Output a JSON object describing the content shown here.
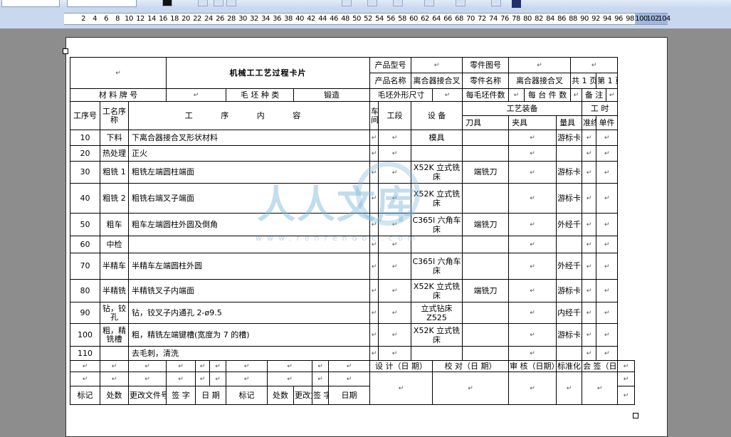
{
  "ruler": {
    "ticks": [
      "2",
      "4",
      "6",
      "8",
      "10",
      "12",
      "14",
      "16",
      "18",
      "20",
      "22",
      "24",
      "26",
      "28",
      "30",
      "32",
      "34",
      "36",
      "38",
      "40",
      "42",
      "44",
      "46",
      "48",
      "50",
      "52",
      "54",
      "56",
      "58",
      "60",
      "62",
      "64",
      "66",
      "68",
      "70",
      "72",
      "74",
      "76",
      "78",
      "80",
      "82",
      "84",
      "86",
      "88",
      "90",
      "92",
      "94",
      "96",
      "98",
      "100",
      "102",
      "104"
    ]
  },
  "card": {
    "title": "机械工工艺过程卡片",
    "product_model_label": "产品型号",
    "part_drawing_label": "零件图号",
    "product_name_label": "产品名称",
    "product_name_value": "离合器接合叉",
    "part_name_label": "零件名称",
    "part_name_value": "离合器接合叉",
    "total_label": "共",
    "total_value": "1",
    "page_label": "页",
    "sheet_label": "第",
    "sheet_value": "1",
    "sheet_page_label": "页",
    "material_label": "材 料 牌 号",
    "blank_type_label": "毛 坯 种 类",
    "blank_type_value": "锻造",
    "blank_size_label": "毛坯外形尺寸",
    "per_blank_label": "每毛坯件数",
    "per_unit_label": "每 台 件 数",
    "notes_label": "备 注",
    "hdr_process_no": "工序号",
    "hdr_process_name": "工名序称",
    "hdr_content": "工 序 内 容",
    "hdr_workshop": "车间",
    "hdr_section": "工段",
    "hdr_equipment": "设 备",
    "hdr_tooling": "工艺装备",
    "hdr_time": "工 时",
    "hdr_cutter": "刀具",
    "hdr_fixture": "夹具",
    "hdr_gauge": "量具",
    "hdr_setup": "准终",
    "hdr_unit": "单件",
    "rows": [
      {
        "no": "10",
        "name": "下料",
        "content": "下离合器接合叉形状材料",
        "equipment": "模具",
        "cutter": "",
        "gauge": "游标卡尺"
      },
      {
        "no": "20",
        "name": "热处理",
        "content": "正火",
        "equipment": "",
        "cutter": "",
        "gauge": ""
      },
      {
        "no": "30",
        "name": "粗铣 1",
        "content": "粗铣左端圆柱端面",
        "equipment": "X52K 立式铣床",
        "cutter": "端铣刀",
        "gauge": "游标卡尺"
      },
      {
        "no": "40",
        "name": "粗铣 2",
        "content": "粗铣右端叉子端面",
        "equipment": "X52K 立式铣床",
        "cutter": "",
        "gauge": "游标卡尺"
      },
      {
        "no": "50",
        "name": "粗车",
        "content": "粗车左端圆柱外圆及倒角",
        "equipment": "C365l 六角车床",
        "cutter": "端铣刀",
        "gauge": "外经千分尺"
      },
      {
        "no": "60",
        "name": "中检",
        "content": "",
        "equipment": "",
        "cutter": "",
        "gauge": ""
      },
      {
        "no": "70",
        "name": "半精车",
        "content": "半精车左端圆柱外圆",
        "equipment": "C365l 六角车床",
        "cutter": "",
        "gauge": "外经千分尺"
      },
      {
        "no": "80",
        "name": "半精铣",
        "content": "半精铣叉子内端面",
        "equipment": "X52K 立式铣床",
        "cutter": "端铣刀",
        "gauge": "游标卡尺"
      },
      {
        "no": "90",
        "name": "钻，铰孔",
        "content": "钻，铰叉子内通孔 2-ø9.5",
        "equipment": "立式钻床 Z525",
        "cutter": "",
        "gauge": "内经千分尺"
      },
      {
        "no": "100",
        "name": "粗，精铣槽",
        "content": "粗，精铣左端键槽(宽度为 7 的槽)",
        "equipment": "X52K 立式铣床",
        "cutter": "",
        "gauge": "游标卡尺"
      },
      {
        "no": "110",
        "name": "",
        "content": "去毛刺，清洗",
        "equipment": "",
        "cutter": "",
        "gauge": ""
      }
    ],
    "footer": {
      "design": "设 计（日 期）",
      "check": "校 对（日 期）",
      "review": "审 核（日期）",
      "standard": "标准化（日期）",
      "countersign": "会 签（日期）",
      "mark": "标记",
      "places": "处数",
      "change_doc": "更改文件号",
      "sign": "签 字",
      "date": "日 期",
      "mark2": "标记",
      "places2": "处数",
      "change_doc2": "更改文件号",
      "sign2": "签 字",
      "date2": "日期"
    }
  },
  "watermark": {
    "text": "人人文库",
    "url": "www.renrendoc.com"
  },
  "colors": {
    "ruler_highlight": "#9fb7dd",
    "toolbar": "#c9d8ee"
  }
}
